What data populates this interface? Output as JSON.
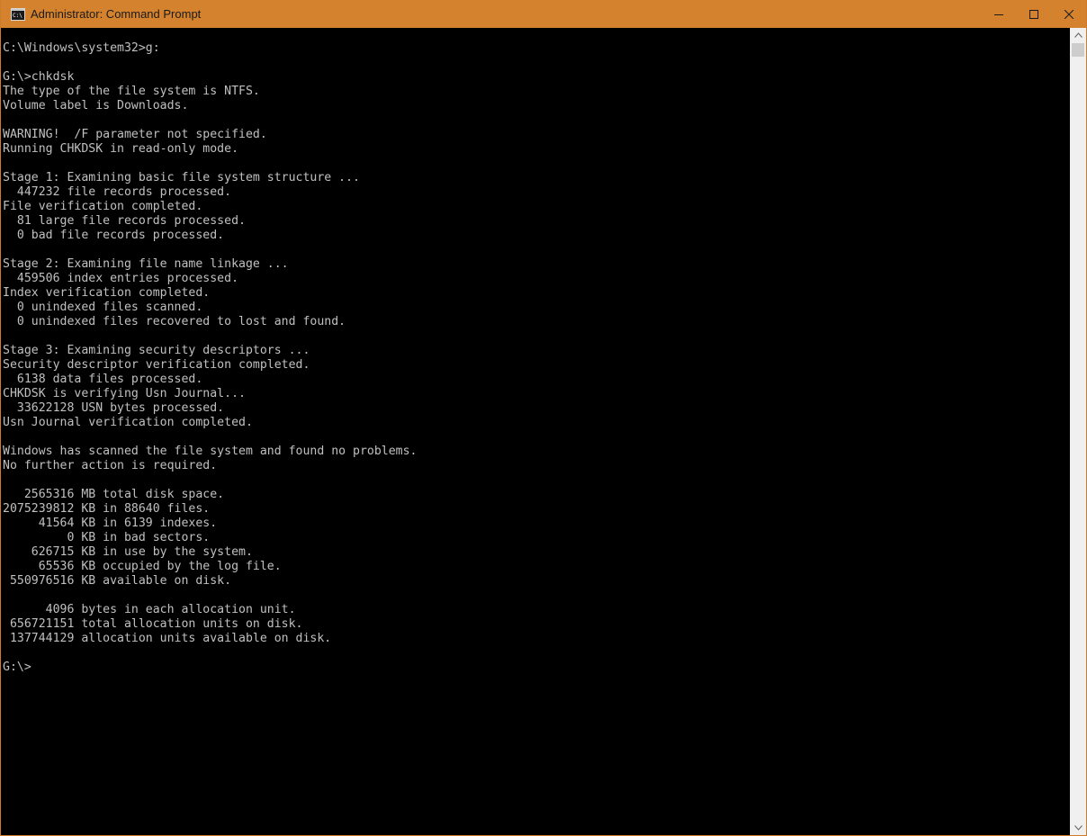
{
  "window": {
    "title": "Administrator: Command Prompt",
    "accent_color": "#d4822e",
    "icons": {
      "app": "cmd-icon",
      "minimize": "minimize-icon",
      "maximize": "maximize-icon",
      "close": "close-icon",
      "scroll_up": "scroll-up-arrow-icon",
      "scroll_down": "scroll-down-arrow-icon"
    }
  },
  "console": {
    "lines": [
      "C:\\Windows\\system32>g:",
      "",
      "G:\\>chkdsk",
      "The type of the file system is NTFS.",
      "Volume label is Downloads.",
      "",
      "WARNING!  /F parameter not specified.",
      "Running CHKDSK in read-only mode.",
      "",
      "Stage 1: Examining basic file system structure ...",
      "  447232 file records processed.",
      "File verification completed.",
      "  81 large file records processed.",
      "  0 bad file records processed.",
      "",
      "Stage 2: Examining file name linkage ...",
      "  459506 index entries processed.",
      "Index verification completed.",
      "  0 unindexed files scanned.",
      "  0 unindexed files recovered to lost and found.",
      "",
      "Stage 3: Examining security descriptors ...",
      "Security descriptor verification completed.",
      "  6138 data files processed.",
      "CHKDSK is verifying Usn Journal...",
      "  33622128 USN bytes processed.",
      "Usn Journal verification completed.",
      "",
      "Windows has scanned the file system and found no problems.",
      "No further action is required.",
      "",
      "   2565316 MB total disk space.",
      "2075239812 KB in 88640 files.",
      "     41564 KB in 6139 indexes.",
      "         0 KB in bad sectors.",
      "    626715 KB in use by the system.",
      "     65536 KB occupied by the log file.",
      " 550976516 KB available on disk.",
      "",
      "      4096 bytes in each allocation unit.",
      " 656721151 total allocation units on disk.",
      " 137744129 allocation units available on disk.",
      "",
      "G:\\>"
    ]
  }
}
